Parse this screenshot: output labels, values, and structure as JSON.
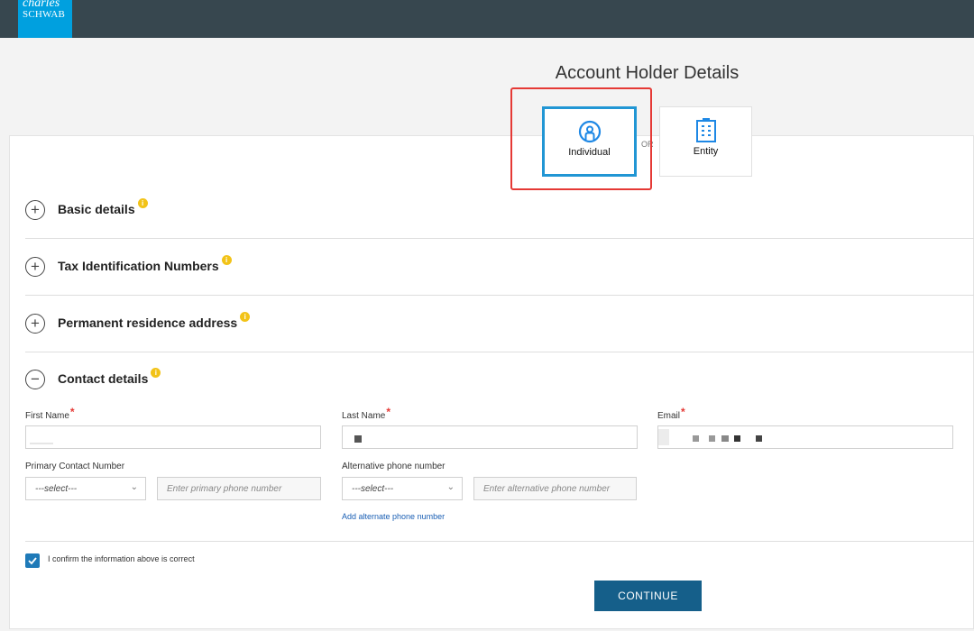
{
  "brand": {
    "line1": "charles",
    "line2": "SCHWAB"
  },
  "page": {
    "title": "Account Holder Details"
  },
  "account_types": {
    "individual_label": "Individual",
    "or_label": "OR",
    "entity_label": "Entity",
    "selected": "Individual"
  },
  "sections": [
    {
      "label": "Basic details",
      "expanded": false
    },
    {
      "label": "Tax Identification Numbers",
      "expanded": false
    },
    {
      "label": "Permanent residence address",
      "expanded": false
    },
    {
      "label": "Contact details",
      "expanded": true
    }
  ],
  "contact": {
    "first_name_label": "First Name",
    "last_name_label": "Last Name",
    "email_label": "Email",
    "required_mark": "*",
    "primary_phone_label": "Primary Contact Number",
    "alternative_phone_label": "Alternative phone number",
    "select_placeholder": "---select---",
    "primary_phone_placeholder": "Enter primary phone number",
    "alternative_phone_placeholder": "Enter alternative phone number",
    "add_alternate_link": "Add alternate phone number"
  },
  "confirm": {
    "label": "I confirm the information above is correct",
    "checked": true
  },
  "actions": {
    "continue_label": "CONTINUE"
  },
  "icons": {
    "toggle_collapsed": "plus-circle-icon",
    "toggle_expanded": "minus-circle-icon",
    "info": "info-icon",
    "check": "checkmark-icon"
  },
  "colors": {
    "topbar": "#37474f",
    "brand": "#00a0df",
    "accent": "#155f8a",
    "selected_border": "#2196d4",
    "highlight": "#e53935",
    "info_badge": "#f2c318"
  }
}
